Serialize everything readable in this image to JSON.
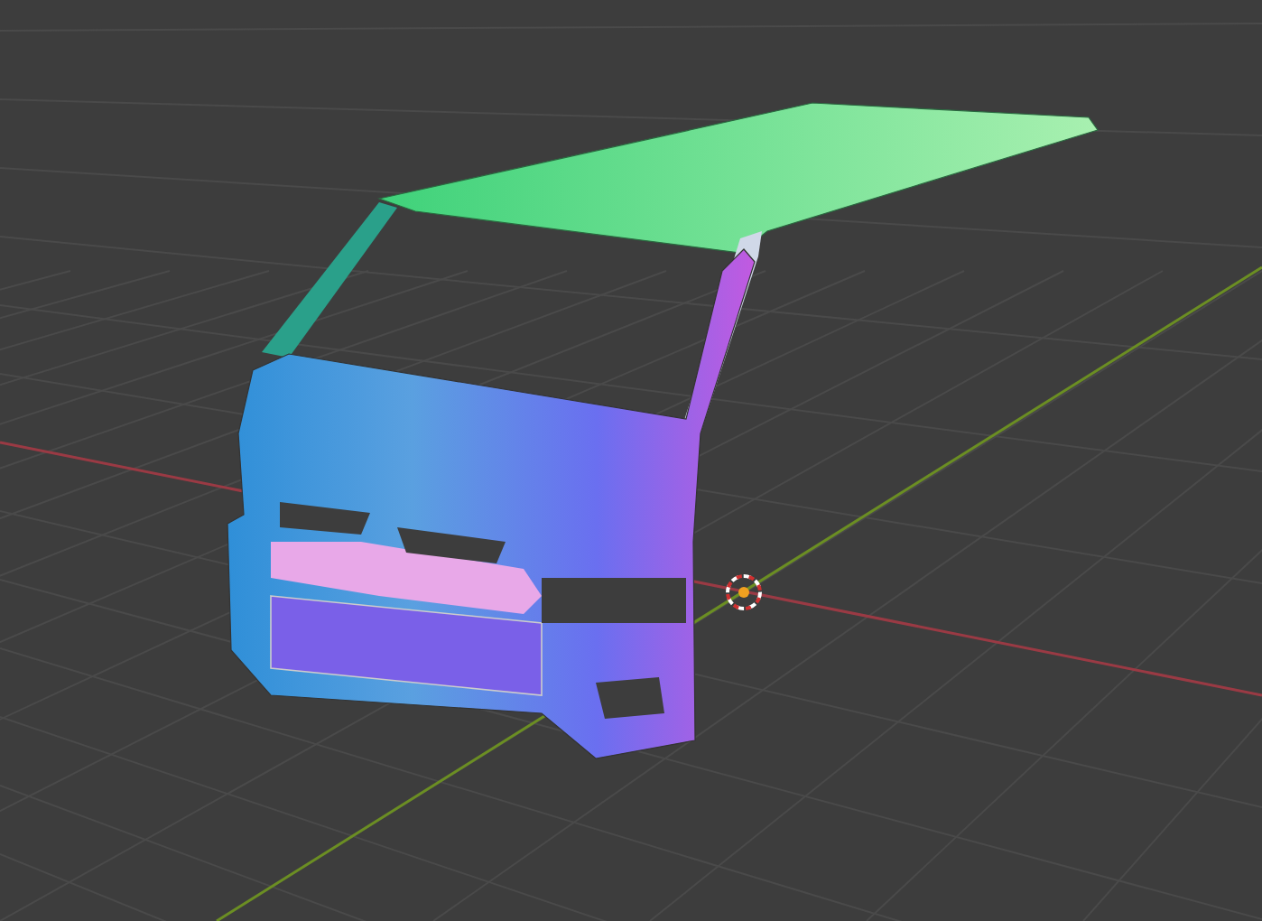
{
  "viewport": {
    "grid": true,
    "axes": true,
    "origin": true
  }
}
